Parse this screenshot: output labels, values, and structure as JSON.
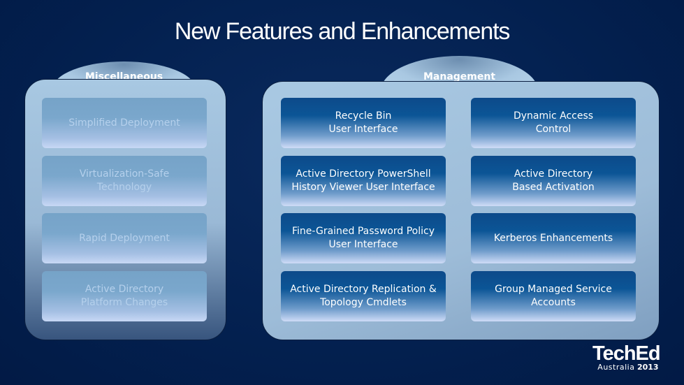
{
  "title": "New Features and Enhancements",
  "groups": [
    {
      "label": "Miscellaneous",
      "items": [
        "Simplified Deployment",
        "Virtualization-Safe Technology",
        "Rapid Deployment",
        "Active Directory Platform Changes"
      ]
    },
    {
      "label": "Management",
      "items": [
        "Recycle Bin User Interface",
        "Dynamic Access Control",
        "Active Directory PowerShell History Viewer User Interface",
        "Active Directory Based Activation",
        "Fine-Grained Password Policy User Interface",
        "Kerberos Enhancements",
        "Active Directory Replication & Topology Cmdlets",
        "Group Managed Service Accounts"
      ]
    }
  ],
  "logo": {
    "name": "TechEd",
    "region": "Australia",
    "year": "2013"
  },
  "colors": {
    "background": "#03204f",
    "pale_box": "#7aa7cc",
    "dark_box": "#0b5596"
  }
}
